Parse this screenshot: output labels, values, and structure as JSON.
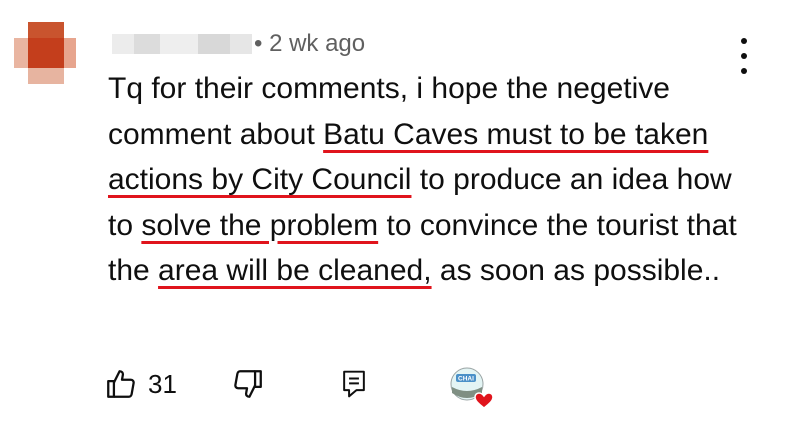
{
  "comment": {
    "author_avatar": "pixelated-avatar",
    "author_name_redacted": true,
    "timestamp": "• 2 wk ago",
    "text": {
      "p1": "Tq for their comments, i hope the negetive comment about ",
      "h1": "Batu Caves must to be taken actions by City Council",
      "p2": " to produce an idea how to ",
      "h2": "solve the problem",
      "p3": " to convince the tourist that the ",
      "h3": "area will be cleaned,",
      "p4": " as soon as possible.."
    },
    "underline_color": "#e0141c"
  },
  "actions": {
    "like_count": "31",
    "like_icon": "thumbs-up-icon",
    "dislike_icon": "thumbs-down-icon",
    "reply_icon": "reply-icon",
    "creator_heart_icon": "creator-heart-icon",
    "creator_avatar_text": "CHAI"
  },
  "menu_icon": "more-vert-icon"
}
